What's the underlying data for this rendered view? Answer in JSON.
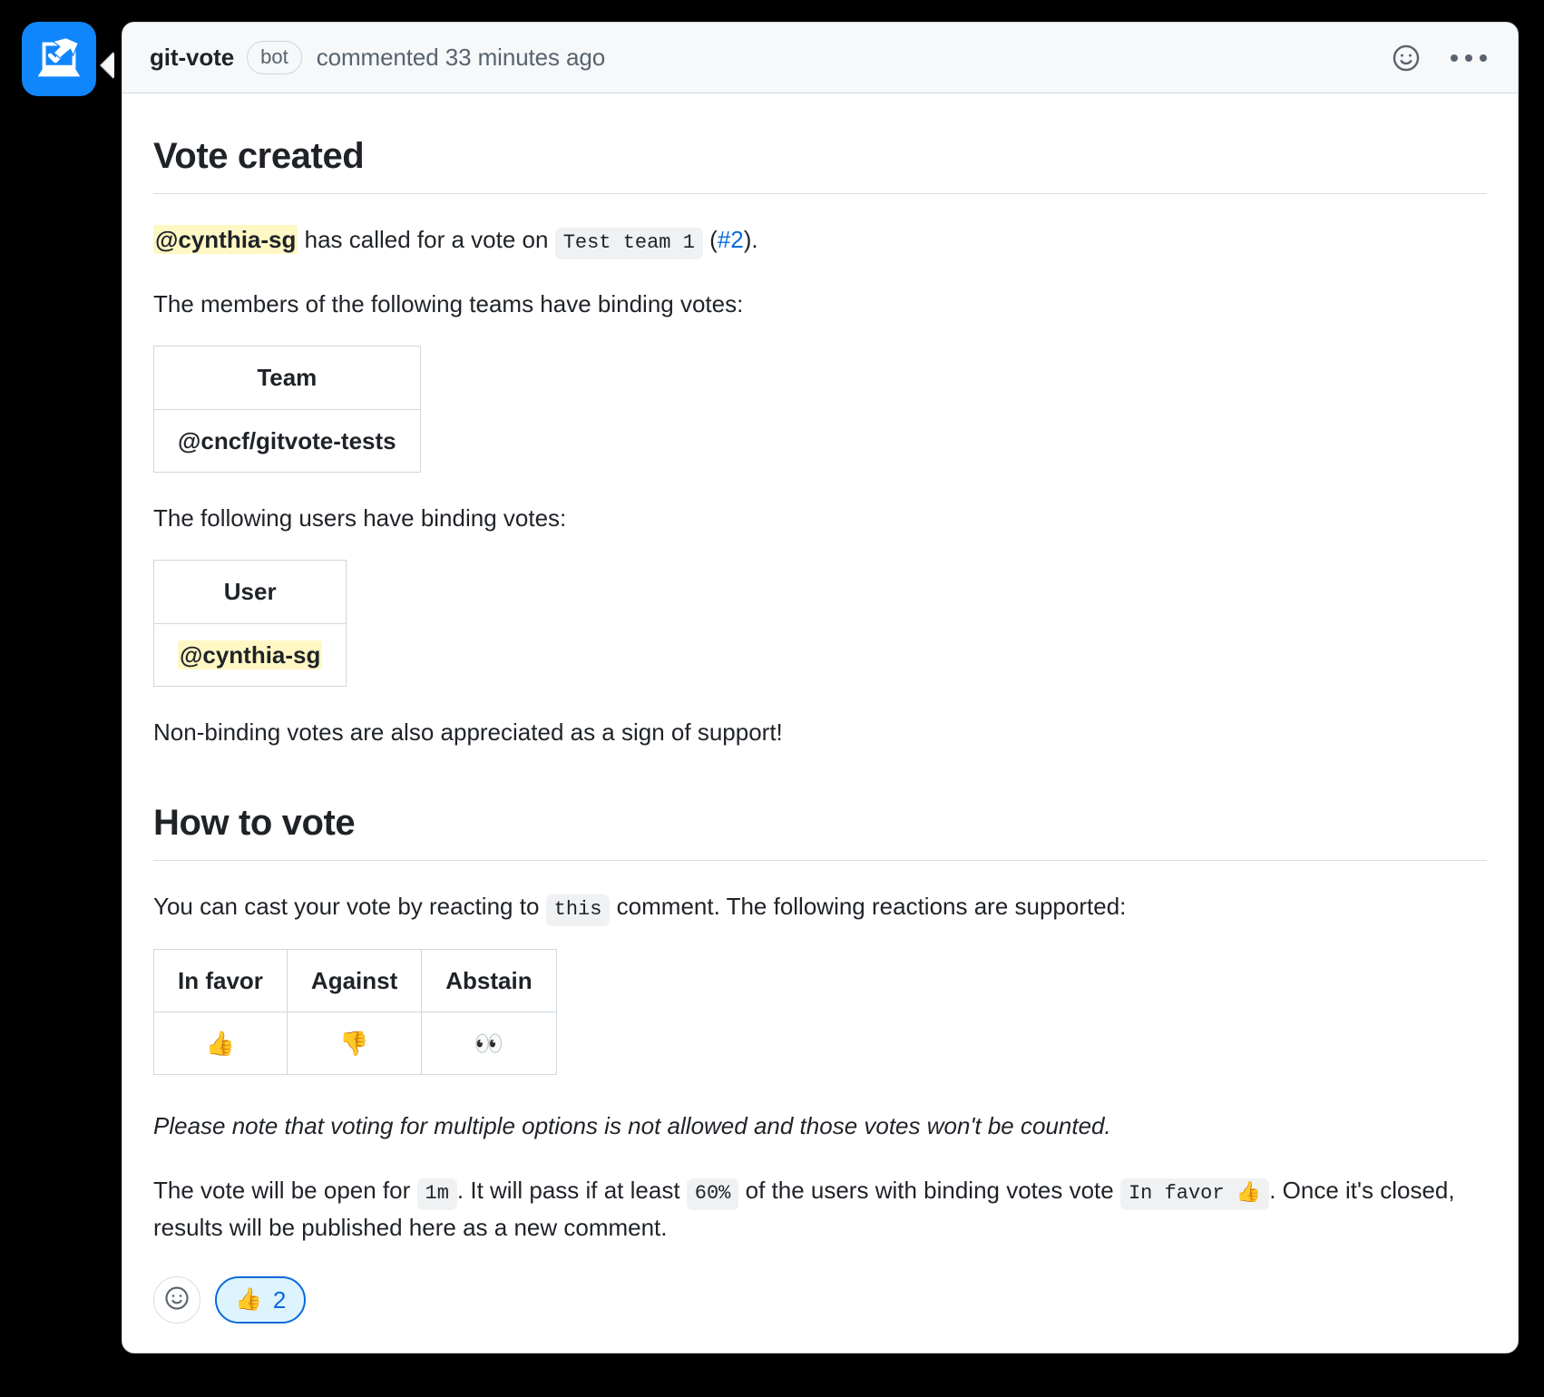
{
  "avatar": {
    "icon": "ballot-box-with-hand-icon",
    "bg": "#0f86fb"
  },
  "header": {
    "author": "git-vote",
    "badge": "bot",
    "commented": "commented 33 minutes ago",
    "reaction_icon": "smiley-icon",
    "menu_icon": "kebab-menu-icon"
  },
  "sections": {
    "vote_created": {
      "title": "Vote created",
      "called_mention": "@cynthia-sg",
      "called_text_1": " has called for a vote on ",
      "called_chip": "Test team 1",
      "called_open_paren": " (",
      "called_link": "#2",
      "called_close": ").",
      "teams_intro": "The members of the following teams have binding votes:",
      "teams_table": {
        "header": "Team",
        "rows": [
          "@cncf/gitvote-tests"
        ]
      },
      "users_intro": "The following users have binding votes:",
      "users_table": {
        "header": "User",
        "rows": [
          "@cynthia-sg"
        ]
      },
      "nonbinding": "Non-binding votes are also appreciated as a sign of support!"
    },
    "how_to_vote": {
      "title": "How to vote",
      "cast_text_1": "You can cast your vote by reacting to ",
      "cast_chip": "this",
      "cast_text_2": " comment. The following reactions are supported:",
      "reaction_table": {
        "headers": [
          "In favor",
          "Against",
          "Abstain"
        ],
        "emojis": [
          "👍",
          "👎",
          "👀"
        ]
      },
      "note": "Please note that voting for multiple options is not allowed and those votes won't be counted.",
      "closing_text_1": "The vote will be open for ",
      "closing_chip_duration": "1m",
      "closing_text_2": ". It will pass if at least ",
      "closing_chip_threshold": "60%",
      "closing_text_3": " of the users with binding votes vote ",
      "closing_chip_option": "In favor 👍",
      "closing_text_4": ".",
      "closing_text_5": "Once it's closed, results will be published here as a new comment."
    }
  },
  "reactions": {
    "add_label": "add-reaction",
    "items": [
      {
        "emoji": "👍",
        "count": "2",
        "active": true
      }
    ]
  },
  "colors": {
    "accent_blue": "#0969da",
    "mention_highlight": "#fff8c5",
    "card_border": "#d0d7de",
    "header_bg": "#f6f8fa",
    "code_bg": "#eff1f3"
  }
}
